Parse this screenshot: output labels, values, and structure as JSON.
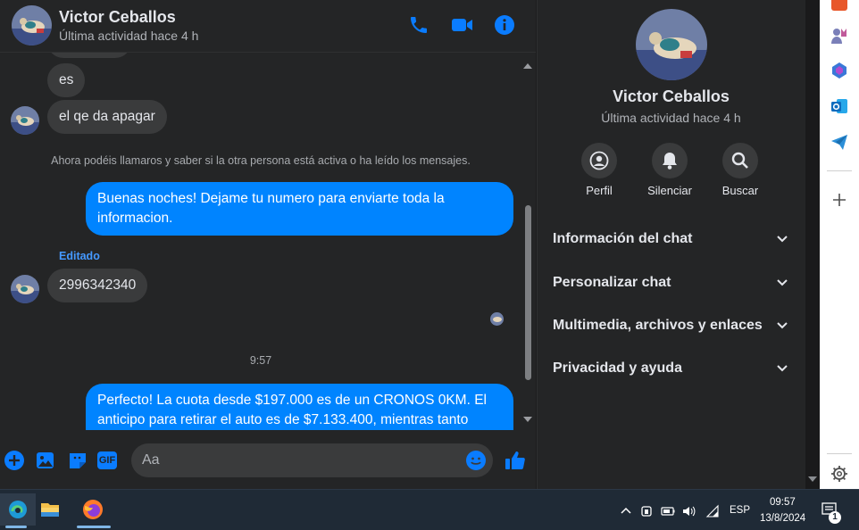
{
  "contact": {
    "name": "Victor Ceballos",
    "status": "Última actividad hace 4 h"
  },
  "header_icons": [
    "phone-icon",
    "video-icon",
    "info-icon"
  ],
  "conversation": {
    "msg_es": "es",
    "msg_apagar": "el qe da  apagar",
    "system_note": "Ahora podéis llamaros y saber si la otra persona está activa o ha leído los mensajes.",
    "msg_out_1": "Buenas noches! Dejame tu numero para enviarte toda la informacion.",
    "edited_label": "Editado",
    "msg_phone": "2996342340",
    "time_label": "9:57",
    "msg_out_2": "Perfecto! La cuota desde $197.000 es de un CRONOS 0KM. El anticipo para retirar el auto es de $7.133.400, mientras tanto"
  },
  "composer": {
    "placeholder": "Aa",
    "icons": [
      "plus-icon",
      "image-icon",
      "sticker-icon",
      "gif-icon",
      "emoji-icon",
      "like-icon"
    ],
    "gif_label": "GIF"
  },
  "info_panel": {
    "actions": [
      {
        "label": "Perfil",
        "icon": "profile-icon"
      },
      {
        "label": "Silenciar",
        "icon": "bell-icon"
      },
      {
        "label": "Buscar",
        "icon": "search-icon"
      }
    ],
    "sections": [
      {
        "label": "Información del chat"
      },
      {
        "label": "Personalizar chat"
      },
      {
        "label": "Multimedia, archivos y enlaces"
      },
      {
        "label": "Privacidad y ayuda"
      }
    ]
  },
  "colors": {
    "accent": "#0084ff",
    "background": "#242526",
    "incoming_bubble": "#3a3b3c",
    "taskbar": "#1f2a36"
  },
  "taskbar": {
    "apps": [
      "edge-icon",
      "file-explorer-icon",
      "firefox-icon"
    ],
    "language": "ESP",
    "time": "09:57",
    "date": "13/8/2024",
    "notification_count": "1"
  }
}
